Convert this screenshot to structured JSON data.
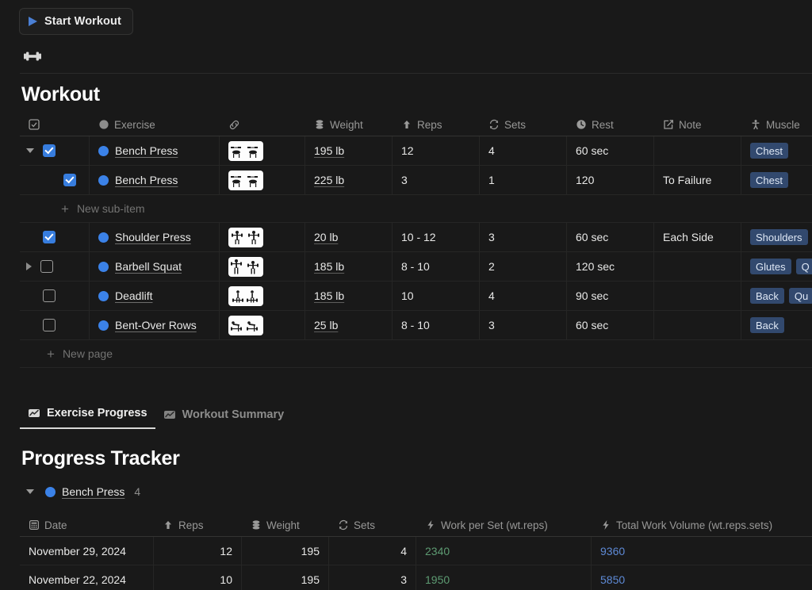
{
  "toolbar": {
    "start_workout_label": "Start Workout",
    "play_icon": "play-icon",
    "dumbbell_icon": "dumbbell-icon"
  },
  "workout": {
    "title": "Workout",
    "columns": [
      {
        "key": "check",
        "label": "",
        "icon": "checkbox-icon"
      },
      {
        "key": "exercise",
        "label": "Exercise",
        "icon": "circle-icon"
      },
      {
        "key": "link",
        "label": "",
        "icon": "link-icon"
      },
      {
        "key": "weight",
        "label": "Weight",
        "icon": "stack-icon"
      },
      {
        "key": "reps",
        "label": "Reps",
        "icon": "arrow-up-icon"
      },
      {
        "key": "sets",
        "label": "Sets",
        "icon": "refresh-icon"
      },
      {
        "key": "rest",
        "label": "Rest",
        "icon": "clock-icon"
      },
      {
        "key": "note",
        "label": "Note",
        "icon": "pencil-square-icon"
      },
      {
        "key": "muscle",
        "label": "Muscle",
        "icon": "person-icon"
      }
    ],
    "rows": [
      {
        "expander": "down",
        "checked": true,
        "indent": false,
        "name": "Bench Press",
        "thumb": "bench-press-thumb",
        "weight": "195 lb",
        "reps": "12",
        "sets": "4",
        "rest": "60 sec",
        "note": "",
        "muscles": [
          "Chest"
        ]
      },
      {
        "expander": "none",
        "checked": true,
        "indent": true,
        "name": "Bench Press",
        "thumb": "bench-press-thumb",
        "weight": "225 lb",
        "reps": "3",
        "sets": "1",
        "rest": "120",
        "note": "To Failure",
        "muscles": [
          "Chest"
        ]
      },
      {
        "expander": "none",
        "checked": true,
        "indent": false,
        "name": "Shoulder Press",
        "thumb": "shoulder-press-thumb",
        "weight": "20 lb",
        "reps": "10 - 12",
        "sets": "3",
        "rest": "60 sec",
        "note": "Each Side",
        "muscles": [
          "Shoulders"
        ]
      },
      {
        "expander": "right",
        "checked": false,
        "indent": false,
        "name": "Barbell Squat",
        "thumb": "barbell-squat-thumb",
        "weight": "185 lb",
        "reps": "8 - 10",
        "sets": "2",
        "rest": "120 sec",
        "note": "",
        "muscles": [
          "Glutes",
          "Q"
        ]
      },
      {
        "expander": "none",
        "checked": false,
        "indent": false,
        "name": "Deadlift",
        "thumb": "deadlift-thumb",
        "weight": "185 lb",
        "reps": "10",
        "sets": "4",
        "rest": "90 sec",
        "note": "",
        "muscles": [
          "Back",
          "Qu"
        ]
      },
      {
        "expander": "none",
        "checked": false,
        "indent": false,
        "name": "Bent-Over Rows",
        "thumb": "bent-over-rows-thumb",
        "weight": "25 lb",
        "reps": "8 - 10",
        "sets": "3",
        "rest": "60 sec",
        "note": "",
        "muscles": [
          "Back"
        ]
      }
    ],
    "new_subitem_label": "New sub-item",
    "new_page_label": "New page"
  },
  "tabs": [
    {
      "label": "Exercise Progress",
      "icon": "chart-icon",
      "active": true
    },
    {
      "label": "Workout Summary",
      "icon": "chart-icon",
      "active": false
    }
  ],
  "progress": {
    "title": "Progress Tracker",
    "group_name": "Bench Press",
    "group_count": "4",
    "columns": [
      {
        "key": "date",
        "label": "Date",
        "icon": "calendar-icon"
      },
      {
        "key": "reps",
        "label": "Reps",
        "icon": "arrow-up-icon"
      },
      {
        "key": "weight",
        "label": "Weight",
        "icon": "stack-icon"
      },
      {
        "key": "sets",
        "label": "Sets",
        "icon": "refresh-icon"
      },
      {
        "key": "work_per_set",
        "label": "Work per Set (wt.reps)",
        "icon": "bolt-icon"
      },
      {
        "key": "total_work_volume",
        "label": "Total Work Volume (wt.reps.sets)",
        "icon": "bolt-icon"
      }
    ],
    "rows": [
      {
        "date": "November 29, 2024",
        "reps": "12",
        "weight": "195",
        "sets": "4",
        "work_per_set": "2340",
        "total_work_volume": "9360"
      },
      {
        "date": "November 22, 2024",
        "reps": "10",
        "weight": "195",
        "sets": "3",
        "work_per_set": "1950",
        "total_work_volume": "5850"
      }
    ]
  },
  "colors": {
    "background": "#191919",
    "accent_blue": "#3b82e8",
    "tag_bg": "#32496e",
    "work_green": "#5d9b72",
    "volume_blue": "#5e8ad6"
  }
}
